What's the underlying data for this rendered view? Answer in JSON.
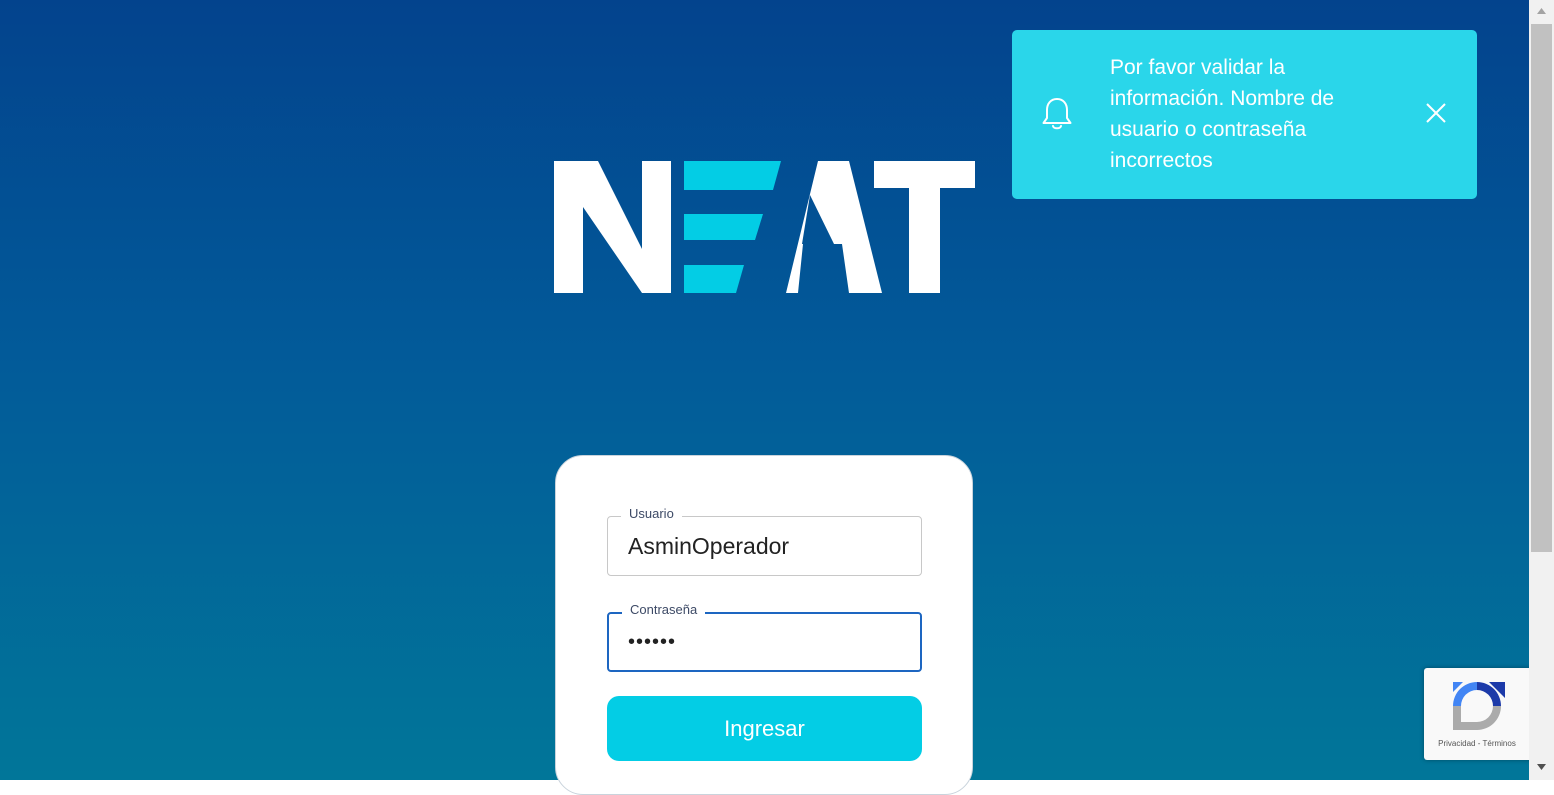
{
  "brand": {
    "logo_text": "NEAT",
    "accent_color": "#03cde5",
    "logo_color": "#ffffff"
  },
  "toast": {
    "icon": "bell-icon",
    "message": "Por favor validar la información. Nombre de usuario o contraseña incorrectos",
    "close_icon": "close-icon",
    "background": "#2ad6ea"
  },
  "login": {
    "username": {
      "label": "Usuario",
      "value": "AsminOperador"
    },
    "password": {
      "label": "Contraseña",
      "value": "••••••"
    },
    "submit_label": "Ingresar"
  },
  "recaptcha": {
    "privacy_label": "Privacidad",
    "separator": " - ",
    "terms_label": "Términos"
  },
  "colors": {
    "background_top": "#03438d",
    "background_bottom": "#017699",
    "focus_border": "#1d66c1"
  }
}
